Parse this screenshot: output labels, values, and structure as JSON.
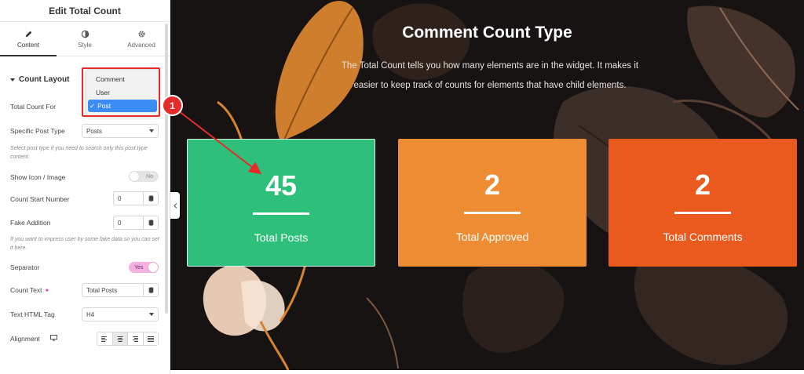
{
  "panel": {
    "title": "Edit Total Count",
    "tabs": [
      {
        "label": "Content",
        "icon": "pencil-icon",
        "active": true
      },
      {
        "label": "Style",
        "icon": "half-circle-icon",
        "active": false
      },
      {
        "label": "Advanced",
        "icon": "gear-icon",
        "active": false
      }
    ],
    "section_title": "Count Layout",
    "controls": {
      "total_count_for": {
        "label": "Total Count For",
        "options": [
          "Comment",
          "User",
          "Post"
        ],
        "selected": "Post"
      },
      "specific_post_type": {
        "label": "Specific Post Type",
        "value": "Posts",
        "help": "Select post type if you need to search only this post type content."
      },
      "show_icon": {
        "label": "Show Icon / Image",
        "toggle_text": "No",
        "on": false
      },
      "count_start_number": {
        "label": "Count Start Number",
        "value": "0"
      },
      "fake_addition": {
        "label": "Fake Addition",
        "value": "0",
        "help": "If you want to impress user by some fake data so you can set it here."
      },
      "separator": {
        "label": "Separator",
        "toggle_text": "Yes",
        "on": true
      },
      "count_text": {
        "label": "Count Text",
        "value": "Total Posts"
      },
      "text_html_tag": {
        "label": "Text HTML Tag",
        "value": "H4"
      },
      "alignment": {
        "label": "Alignment",
        "selected": "center",
        "icons": [
          "align-left-icon",
          "align-center-icon",
          "align-right-icon",
          "align-justify-icon"
        ]
      }
    }
  },
  "annotation": {
    "badge": "1",
    "color": "#e62b2b"
  },
  "preview": {
    "heading": "Comment Count Type",
    "description": "The Total Count tells you how many elements are in the widget. It makes it easier to keep track of counts for elements that have child elements.",
    "cards": [
      {
        "number": "45",
        "label": "Total Posts",
        "color": "#2ec07a"
      },
      {
        "number": "2",
        "label": "Total Approved",
        "color": "#ee8c33"
      },
      {
        "number": "2",
        "label": "Total Comments",
        "color": "#ea5a1e"
      }
    ]
  }
}
